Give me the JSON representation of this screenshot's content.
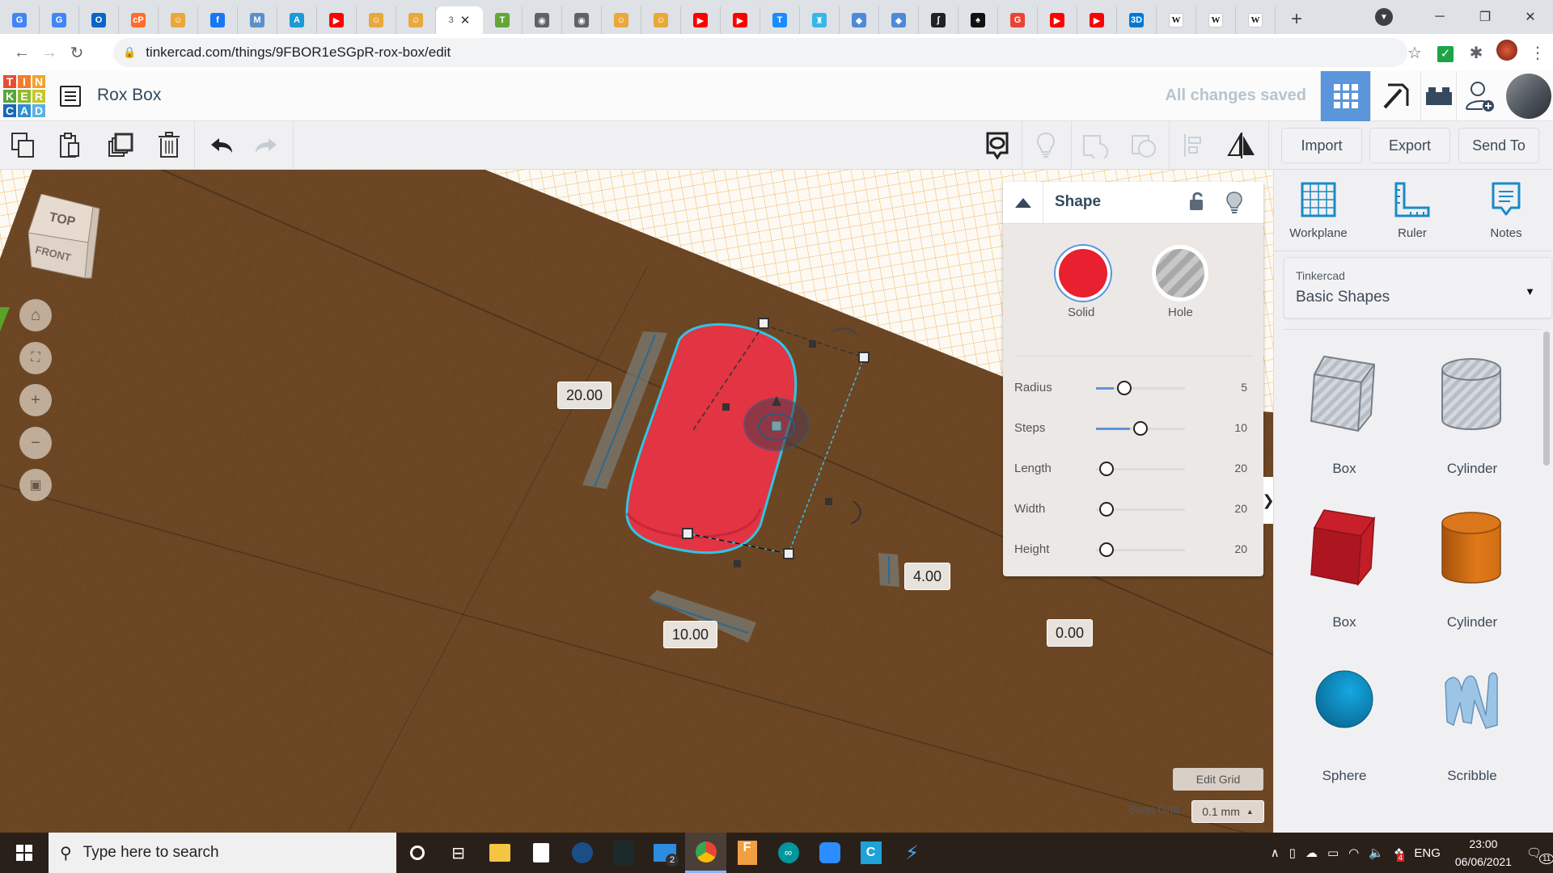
{
  "browser": {
    "tabs": [
      {
        "icon": "google-translate-icon",
        "color": "#4285f4",
        "glyph": "G"
      },
      {
        "icon": "google-translate-icon",
        "color": "#4285f4",
        "glyph": "G"
      },
      {
        "icon": "outlook-icon",
        "color": "#0a64c8",
        "glyph": "O"
      },
      {
        "icon": "cpanel-icon",
        "color": "#ff6c2c",
        "glyph": "cP"
      },
      {
        "icon": "scratch-cat-icon",
        "color": "#e9a83a",
        "glyph": "☺"
      },
      {
        "icon": "facebook-icon",
        "color": "#1877f2",
        "glyph": "f"
      },
      {
        "icon": "makecode-icon",
        "color": "#5b8fc9",
        "glyph": "M"
      },
      {
        "icon": "autodesk-icon",
        "color": "#1a9ad6",
        "glyph": "A"
      },
      {
        "icon": "youtube-icon",
        "color": "#ff0000",
        "glyph": "▶"
      },
      {
        "icon": "scratch-cat-icon",
        "color": "#e9a83a",
        "glyph": "☺"
      },
      {
        "icon": "scratch-cat-icon",
        "color": "#e9a83a",
        "glyph": "☺"
      },
      {
        "icon": "tinkercad-icon",
        "color": "#e84d32",
        "glyph": "T",
        "active": true
      },
      {
        "icon": "tinkercad-icon",
        "color": "#62a638",
        "glyph": "T"
      },
      {
        "icon": "globe-icon",
        "color": "#5f6368",
        "glyph": "◉"
      },
      {
        "icon": "globe-icon",
        "color": "#5f6368",
        "glyph": "◉"
      },
      {
        "icon": "scratch-cat-icon",
        "color": "#e9a83a",
        "glyph": "☺"
      },
      {
        "icon": "scratch-cat-icon",
        "color": "#e9a83a",
        "glyph": "☺"
      },
      {
        "icon": "youtube-icon",
        "color": "#ff0000",
        "glyph": "▶"
      },
      {
        "icon": "youtube-icon",
        "color": "#ff0000",
        "glyph": "▶"
      },
      {
        "icon": "tinkercad-t-icon",
        "color": "#1a8cff",
        "glyph": "T"
      },
      {
        "icon": "kid-robot-icon",
        "color": "#38b6e8",
        "glyph": "♜"
      },
      {
        "icon": "book-icon",
        "color": "#4d8ad8",
        "glyph": "◆"
      },
      {
        "icon": "book-icon",
        "color": "#4d8ad8",
        "glyph": "◆"
      },
      {
        "icon": "script-icon",
        "color": "#222222",
        "glyph": "ʃ"
      },
      {
        "icon": "inkscape-icon",
        "color": "#111111",
        "glyph": "♠"
      },
      {
        "icon": "google-icon",
        "color": "#ea4335",
        "glyph": "G"
      },
      {
        "icon": "youtube-icon",
        "color": "#ff0000",
        "glyph": "▶"
      },
      {
        "icon": "youtube-icon",
        "color": "#ff0000",
        "glyph": "▶"
      },
      {
        "icon": "3d-icon",
        "color": "#0078d7",
        "glyph": "3D"
      },
      {
        "icon": "wikipedia-icon",
        "color": "#ffffff",
        "glyph": "W"
      },
      {
        "icon": "wikipedia-icon",
        "color": "#ffffff",
        "glyph": "W"
      },
      {
        "icon": "wikipedia-icon",
        "color": "#ffffff",
        "glyph": "W"
      }
    ],
    "active_tab_number": "3",
    "url": "tinkercad.com/things/9FBOR1eSGpR-rox-box/edit"
  },
  "app": {
    "logo_letters": [
      "T",
      "I",
      "N",
      "K",
      "E",
      "R",
      "C",
      "A",
      "D"
    ],
    "logo_colors": [
      "#e84d32",
      "#f37c2b",
      "#f3a12b",
      "#56a53e",
      "#8fba2b",
      "#c2c92a",
      "#1a66b5",
      "#2f8fd1",
      "#5ab2e2"
    ],
    "project_title": "Rox Box",
    "save_status": "All changes saved"
  },
  "toolbar": {
    "import_label": "Import",
    "export_label": "Export",
    "sendto_label": "Send To"
  },
  "viewport": {
    "viewcube_top": "TOP",
    "viewcube_front": "FRONT",
    "dimensions": {
      "length": "20.00",
      "width": "10.00",
      "height": "4.00",
      "elevation": "0.00"
    },
    "edit_grid_label": "Edit Grid",
    "snap_grid_label": "Snap Grid",
    "snap_grid_value": "0.1 mm"
  },
  "shape_panel": {
    "title": "Shape",
    "solid_label": "Solid",
    "hole_label": "Hole",
    "solid_color": "#e8202f",
    "params": [
      {
        "label": "Radius",
        "value": "5",
        "fraction": 0.2
      },
      {
        "label": "Steps",
        "value": "10",
        "fraction": 0.38
      },
      {
        "label": "Length",
        "value": "20",
        "fraction": 0.0
      },
      {
        "label": "Width",
        "value": "20",
        "fraction": 0.0
      },
      {
        "label": "Height",
        "value": "20",
        "fraction": 0.0
      }
    ]
  },
  "sidebar": {
    "tools": [
      {
        "label": "Workplane",
        "icon": "workplane-icon"
      },
      {
        "label": "Ruler",
        "icon": "ruler-icon"
      },
      {
        "label": "Notes",
        "icon": "notes-icon"
      }
    ],
    "library_provider": "Tinkercad",
    "library_name": "Basic Shapes",
    "shapes": [
      {
        "label": "Box",
        "kind": "box-hole"
      },
      {
        "label": "Cylinder",
        "kind": "cylinder-hole"
      },
      {
        "label": "Box",
        "kind": "box"
      },
      {
        "label": "Cylinder",
        "kind": "cylinder"
      },
      {
        "label": "Sphere",
        "kind": "sphere"
      },
      {
        "label": "Scribble",
        "kind": "scribble"
      }
    ]
  },
  "taskbar": {
    "search_placeholder": "Type here to search",
    "mail_badge": "2",
    "language": "ENG",
    "time": "23:00",
    "date": "06/06/2021",
    "notification_count": "11",
    "tray_badge": "4"
  }
}
